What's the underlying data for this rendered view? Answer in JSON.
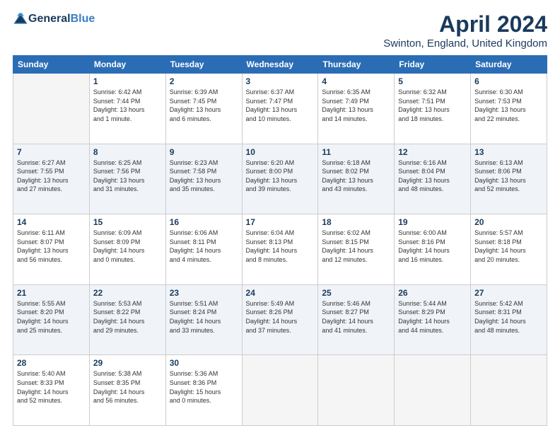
{
  "header": {
    "logo_general": "General",
    "logo_blue": "Blue",
    "title": "April 2024",
    "location": "Swinton, England, United Kingdom"
  },
  "days_of_week": [
    "Sunday",
    "Monday",
    "Tuesday",
    "Wednesday",
    "Thursday",
    "Friday",
    "Saturday"
  ],
  "weeks": [
    [
      {
        "day": "",
        "info": ""
      },
      {
        "day": "1",
        "info": "Sunrise: 6:42 AM\nSunset: 7:44 PM\nDaylight: 13 hours\nand 1 minute."
      },
      {
        "day": "2",
        "info": "Sunrise: 6:39 AM\nSunset: 7:45 PM\nDaylight: 13 hours\nand 6 minutes."
      },
      {
        "day": "3",
        "info": "Sunrise: 6:37 AM\nSunset: 7:47 PM\nDaylight: 13 hours\nand 10 minutes."
      },
      {
        "day": "4",
        "info": "Sunrise: 6:35 AM\nSunset: 7:49 PM\nDaylight: 13 hours\nand 14 minutes."
      },
      {
        "day": "5",
        "info": "Sunrise: 6:32 AM\nSunset: 7:51 PM\nDaylight: 13 hours\nand 18 minutes."
      },
      {
        "day": "6",
        "info": "Sunrise: 6:30 AM\nSunset: 7:53 PM\nDaylight: 13 hours\nand 22 minutes."
      }
    ],
    [
      {
        "day": "7",
        "info": "Sunrise: 6:27 AM\nSunset: 7:55 PM\nDaylight: 13 hours\nand 27 minutes."
      },
      {
        "day": "8",
        "info": "Sunrise: 6:25 AM\nSunset: 7:56 PM\nDaylight: 13 hours\nand 31 minutes."
      },
      {
        "day": "9",
        "info": "Sunrise: 6:23 AM\nSunset: 7:58 PM\nDaylight: 13 hours\nand 35 minutes."
      },
      {
        "day": "10",
        "info": "Sunrise: 6:20 AM\nSunset: 8:00 PM\nDaylight: 13 hours\nand 39 minutes."
      },
      {
        "day": "11",
        "info": "Sunrise: 6:18 AM\nSunset: 8:02 PM\nDaylight: 13 hours\nand 43 minutes."
      },
      {
        "day": "12",
        "info": "Sunrise: 6:16 AM\nSunset: 8:04 PM\nDaylight: 13 hours\nand 48 minutes."
      },
      {
        "day": "13",
        "info": "Sunrise: 6:13 AM\nSunset: 8:06 PM\nDaylight: 13 hours\nand 52 minutes."
      }
    ],
    [
      {
        "day": "14",
        "info": "Sunrise: 6:11 AM\nSunset: 8:07 PM\nDaylight: 13 hours\nand 56 minutes."
      },
      {
        "day": "15",
        "info": "Sunrise: 6:09 AM\nSunset: 8:09 PM\nDaylight: 14 hours\nand 0 minutes."
      },
      {
        "day": "16",
        "info": "Sunrise: 6:06 AM\nSunset: 8:11 PM\nDaylight: 14 hours\nand 4 minutes."
      },
      {
        "day": "17",
        "info": "Sunrise: 6:04 AM\nSunset: 8:13 PM\nDaylight: 14 hours\nand 8 minutes."
      },
      {
        "day": "18",
        "info": "Sunrise: 6:02 AM\nSunset: 8:15 PM\nDaylight: 14 hours\nand 12 minutes."
      },
      {
        "day": "19",
        "info": "Sunrise: 6:00 AM\nSunset: 8:16 PM\nDaylight: 14 hours\nand 16 minutes."
      },
      {
        "day": "20",
        "info": "Sunrise: 5:57 AM\nSunset: 8:18 PM\nDaylight: 14 hours\nand 20 minutes."
      }
    ],
    [
      {
        "day": "21",
        "info": "Sunrise: 5:55 AM\nSunset: 8:20 PM\nDaylight: 14 hours\nand 25 minutes."
      },
      {
        "day": "22",
        "info": "Sunrise: 5:53 AM\nSunset: 8:22 PM\nDaylight: 14 hours\nand 29 minutes."
      },
      {
        "day": "23",
        "info": "Sunrise: 5:51 AM\nSunset: 8:24 PM\nDaylight: 14 hours\nand 33 minutes."
      },
      {
        "day": "24",
        "info": "Sunrise: 5:49 AM\nSunset: 8:26 PM\nDaylight: 14 hours\nand 37 minutes."
      },
      {
        "day": "25",
        "info": "Sunrise: 5:46 AM\nSunset: 8:27 PM\nDaylight: 14 hours\nand 41 minutes."
      },
      {
        "day": "26",
        "info": "Sunrise: 5:44 AM\nSunset: 8:29 PM\nDaylight: 14 hours\nand 44 minutes."
      },
      {
        "day": "27",
        "info": "Sunrise: 5:42 AM\nSunset: 8:31 PM\nDaylight: 14 hours\nand 48 minutes."
      }
    ],
    [
      {
        "day": "28",
        "info": "Sunrise: 5:40 AM\nSunset: 8:33 PM\nDaylight: 14 hours\nand 52 minutes."
      },
      {
        "day": "29",
        "info": "Sunrise: 5:38 AM\nSunset: 8:35 PM\nDaylight: 14 hours\nand 56 minutes."
      },
      {
        "day": "30",
        "info": "Sunrise: 5:36 AM\nSunset: 8:36 PM\nDaylight: 15 hours\nand 0 minutes."
      },
      {
        "day": "",
        "info": ""
      },
      {
        "day": "",
        "info": ""
      },
      {
        "day": "",
        "info": ""
      },
      {
        "day": "",
        "info": ""
      }
    ]
  ]
}
